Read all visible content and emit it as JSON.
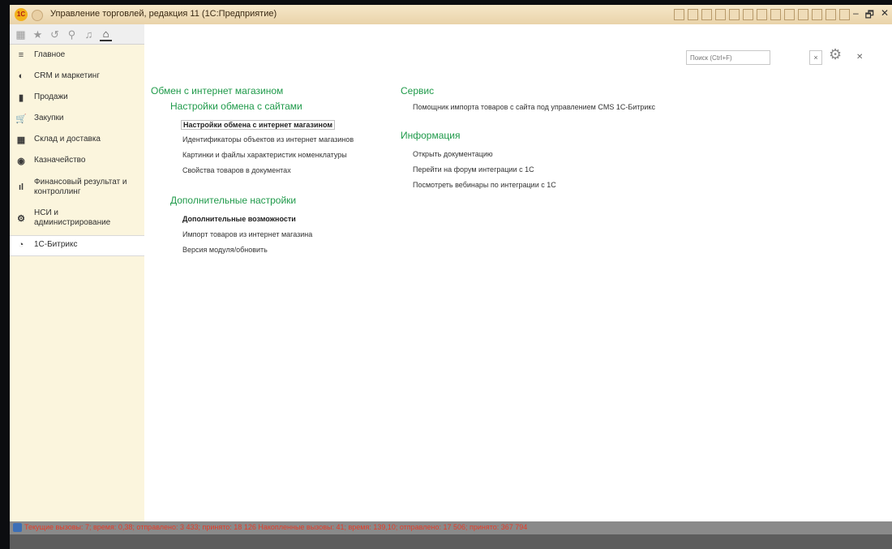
{
  "window": {
    "title": "Управление торговлей, редакция 11  (1С:Предприятие)",
    "controls": {
      "minimize": "–",
      "restore": "🗗",
      "close": "✕"
    }
  },
  "toolbar": {
    "icons": [
      "grid-icon",
      "star-icon",
      "history-icon",
      "search-icon",
      "bell-icon",
      "home-icon"
    ]
  },
  "sidebar": {
    "items": [
      {
        "label": "Главное",
        "icon": "≡"
      },
      {
        "label": "CRM и маркетинг",
        "icon": "◐"
      },
      {
        "label": "Продажи",
        "icon": "▮"
      },
      {
        "label": "Закупки",
        "icon": "🛒"
      },
      {
        "label": "Склад и доставка",
        "icon": "▦"
      },
      {
        "label": "Казначейство",
        "icon": "◉"
      },
      {
        "label": "Финансовый результат и контроллинг",
        "icon": "ıl"
      },
      {
        "label": "НСИ и администрирование",
        "icon": "⚙"
      },
      {
        "label": "1С-Битрикс",
        "icon": "◔"
      }
    ]
  },
  "content": {
    "search_placeholder": "Поиск (Ctrl+F)",
    "left": {
      "section_title": "Обмен с интернет магазином",
      "group1_title": "Настройки обмена с сайтами",
      "group1_links": [
        "Настройки обмена с интернет магазином",
        "Идентификаторы объектов из интернет магазинов",
        "Картинки и файлы характеристик номенклатуры",
        "Свойства товаров в документах"
      ],
      "group2_title": "Дополнительные настройки",
      "group2_links": [
        "Дополнительные возможности",
        "Импорт товаров из интернет магазина",
        "Версия модуля/обновить"
      ]
    },
    "right": {
      "service_title": "Сервис",
      "service_links": [
        "Помощник импорта товаров с сайта под управлением CMS 1С-Битрикс"
      ],
      "info_title": "Информация",
      "info_links": [
        "Открыть документацию",
        "Перейти на форум интеграции с 1С",
        "Посмотреть вебинары по интеграции с 1С"
      ]
    }
  },
  "statusbar": {
    "text": "Текущие вызовы: 7; время: 0,38; отправлено: 3 433; принято: 18 126    Накопленные вызовы: 41; время: 139,10; отправлено: 17 506; принято: 367 794"
  },
  "colors": {
    "accent_green": "#1f9a4a",
    "sidebar_bg": "#fbf5dd",
    "status_text": "#e53b28"
  }
}
